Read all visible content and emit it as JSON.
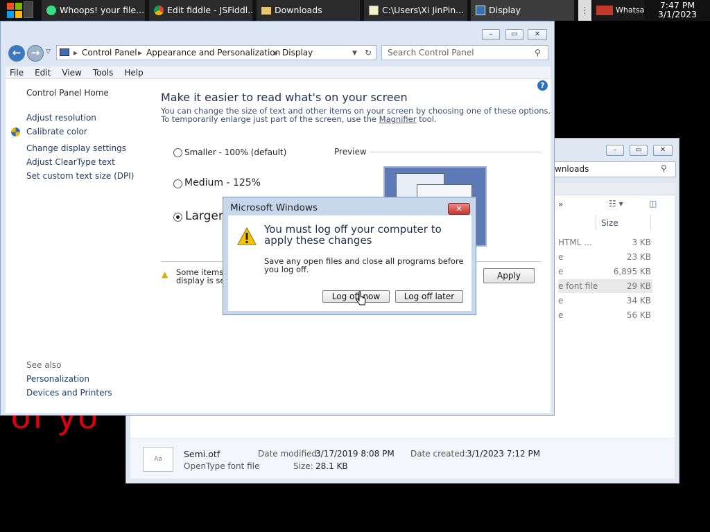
{
  "taskbar": {
    "items": [
      {
        "label": "Whoops! your file...",
        "icon": "chat-bubble-icon"
      },
      {
        "label": "Edit fiddle - JSFiddl...",
        "icon": "chrome-icon"
      },
      {
        "label": "Downloads",
        "icon": "folder-icon"
      },
      {
        "label": "C:\\Users\\Xi JinPin...",
        "icon": "notepad-icon"
      },
      {
        "label": "Display",
        "icon": "display-icon"
      },
      {
        "label": "Whatsapp",
        "icon": "whatsapp-icon"
      }
    ],
    "time": "7:47 PM",
    "date": "3/1/2023"
  },
  "background_text": "of yo",
  "explorer": {
    "address": "wnloads",
    "columns": {
      "size": "Size"
    },
    "rows": [
      {
        "type": "HTML ...",
        "size": "3 KB"
      },
      {
        "type": "e",
        "size": "23 KB"
      },
      {
        "type": "e",
        "size": "6,895 KB"
      },
      {
        "type": "e font file",
        "size": "29 KB"
      },
      {
        "type": "e",
        "size": "34 KB"
      },
      {
        "type": "e",
        "size": "56 KB"
      }
    ],
    "details": {
      "filename": "Semi.otf",
      "filetype": "OpenType font file",
      "modified_label": "Date modified:",
      "modified": "3/17/2019 8:08 PM",
      "created_label": "Date created:",
      "created": "3/1/2023 7:12 PM",
      "size_label": "Size:",
      "size": "28.1 KB"
    }
  },
  "controlpanel": {
    "breadcrumb": [
      "Control Panel",
      "Appearance and Personalization",
      "Display"
    ],
    "search_placeholder": "Search Control Panel",
    "menu": [
      "File",
      "Edit",
      "View",
      "Tools",
      "Help"
    ],
    "sidebar": {
      "home": "Control Panel Home",
      "links": [
        "Adjust resolution",
        "Calibrate color",
        "Change display settings",
        "Adjust ClearType text",
        "Set custom text size (DPI)"
      ],
      "see_also": "See also",
      "see_also_links": [
        "Personalization",
        "Devices and Printers"
      ]
    },
    "heading": "Make it easier to read what's on your screen",
    "desc1": "You can change the size of text and other items on your screen by choosing one of these options.",
    "desc2_pre": "To temporarily enlarge just part of the screen, use the",
    "desc2_link": "Magnifier",
    "desc2_post": "tool.",
    "options": [
      {
        "label": "Smaller - 100% (default)",
        "selected": false
      },
      {
        "label": "Medium - 125%",
        "selected": false
      },
      {
        "label": "Larger",
        "selected": true
      }
    ],
    "preview_label": "Preview",
    "warning_line1": "Some items",
    "warning_line2": "display is set",
    "apply": "Apply"
  },
  "dialog": {
    "title": "Microsoft Windows",
    "heading_line1": "You must log off your computer to",
    "heading_line2": "apply these changes",
    "body_line1": "Save any open files and close all programs before",
    "body_line2": "you log off.",
    "btn_now": "Log off now",
    "btn_later": "Log off later"
  }
}
